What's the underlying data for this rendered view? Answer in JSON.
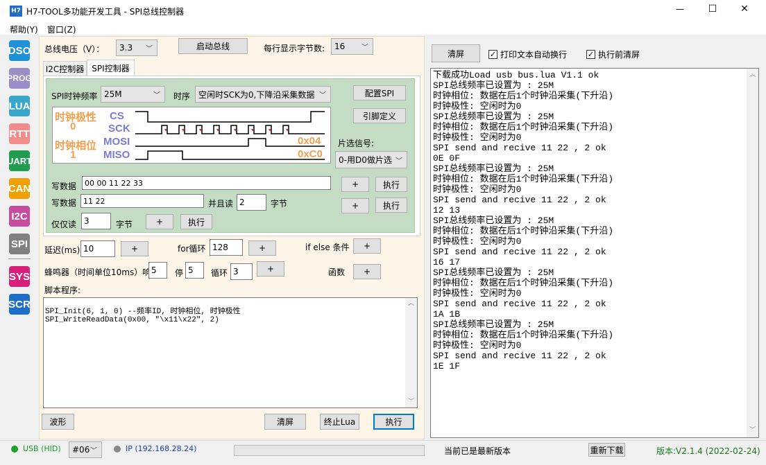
{
  "window": {
    "title": "H7-TOOL多功能开发工具 - SPI总线控制器",
    "app_icon": "H7",
    "min_glyph": "—",
    "max_glyph": "☐",
    "close_glyph": "✕"
  },
  "menu": [
    "帮助(Y)",
    "窗口(Z)"
  ],
  "sidebar": [
    {
      "label": "DSO",
      "color": "#1e90d8"
    },
    {
      "label": "PROG",
      "color": "#9b8dc8"
    },
    {
      "label": "LUA",
      "color": "#37a6c8"
    },
    {
      "label": "RTT",
      "color": "#f08c8c"
    },
    {
      "label": "UART",
      "color": "#1e9e4e"
    },
    {
      "label": "CAN",
      "color": "#f0a000"
    },
    {
      "label": "I2C",
      "color": "#c84c9e"
    },
    {
      "label": "SPI",
      "color": "#808080"
    },
    {
      "label": "SYS",
      "color": "#d8207a"
    },
    {
      "label": "SCR",
      "color": "#1e6ec8"
    }
  ],
  "top": {
    "voltage_label": "总线电压（V）：",
    "voltage_value": "3.3",
    "start_bus": "启动总线",
    "bytes_per_line_label": "每行显示字节数:",
    "bytes_per_line_value": "16"
  },
  "tabs": [
    "I2C控制器",
    "SPI控制器"
  ],
  "spi": {
    "clock_label": "SPI时钟频率",
    "clock_value": "25M",
    "timing_label": "时序",
    "timing_value": "空闲时SCK为0,下降沿采集数据",
    "config_btn": "配置SPI",
    "pin_btn": "引脚定义",
    "cs_select_label": "片选信号:",
    "cs_select_value": "0-用D0做片选",
    "wave": {
      "polarity_label": "时钟极性",
      "polarity_value": "0",
      "phase_label": "时钟相位",
      "phase_value": "1",
      "cs": "CS",
      "sck": "SCK",
      "mosi": "MOSI",
      "miso": "MISO",
      "mosi_hex": "0x04",
      "miso_hex": "0xC0"
    },
    "write1_label": "写数据",
    "write1_value": "00 00 11 22 33",
    "write2_label": "写数据",
    "write2_value": "11 22",
    "and_read_label": "并且读",
    "and_read_value": "2",
    "bytes_unit": "字节",
    "read_only_label": "仅仅读",
    "read_only_value": "3",
    "bytes_unit2": "字节",
    "plus": "+",
    "exec": "执行"
  },
  "script": {
    "delay_label": "延迟(ms)",
    "delay_value": "10",
    "for_label": "for循环",
    "for_value": "128",
    "ifelse_label": "if else 条件",
    "beep_label": "蜂鸣器（时间单位10ms）响",
    "beep_on": "5",
    "stop_label": "停",
    "beep_off": "5",
    "loop_label": "循环",
    "loop_value": "3",
    "func_label": "函数",
    "program_label": "脚本程序:",
    "lines": [
      "SPI_Init(6, 1, 0) --频率ID, 时钟相位, 时钟极性",
      "SPI_WriteReadData(0x00, \"\\x11\\x22\", 2)"
    ],
    "wave_btn": "波形",
    "clear_btn": "清屏",
    "stop_lua_btn": "终止Lua",
    "run_btn": "执行"
  },
  "right": {
    "clear_btn": "清屏",
    "auto_wrap": "打印文本自动换行",
    "clear_before": "执行前清屏",
    "log": [
      "下载成功Load usb bus.lua V1.1 ok",
      "SPI总线频率已设置为 : 25M",
      "时钟相位: 数据在后1个时钟沿采集(下升沿)",
      "时钟极性: 空闲时为0",
      "SPI总线频率已设置为 : 25M",
      "时钟相位: 数据在后1个时钟沿采集(下升沿)",
      "时钟极性: 空闲时为0",
      "SPI send and recive 11 22 , 2 ok",
      "0E 0F",
      "SPI总线频率已设置为 : 25M",
      "时钟相位: 数据在后1个时钟沿采集(下升沿)",
      "时钟极性: 空闲时为0",
      "SPI send and recive 11 22 , 2 ok",
      "12 13",
      "SPI总线频率已设置为 : 25M",
      "时钟相位: 数据在后1个时钟沿采集(下升沿)",
      "时钟极性: 空闲时为0",
      "SPI send and recive 11 22 , 2 ok",
      "16 17",
      "SPI总线频率已设置为 : 25M",
      "时钟相位: 数据在后1个时钟沿采集(下升沿)",
      "时钟极性: 空闲时为0",
      "SPI send and recive 11 22 , 2 ok",
      "1A 1B",
      "SPI总线频率已设置为 : 25M",
      "时钟相位: 数据在后1个时钟沿采集(下升沿)",
      "时钟极性: 空闲时为0",
      "SPI send and recive 11 22 , 2 ok",
      "1E 1F"
    ]
  },
  "status": {
    "usb": "USB (HID)",
    "device": "#06",
    "ip": "IP (192.168.28.24)",
    "latest": "当前已是最新版本",
    "redownload": "重新下载",
    "version": "版本:V2.1.4 (2022-02-24)",
    "usb_color": "#1a9e2e",
    "ip_color": "#1e3ea8",
    "version_color": "#1a7a1a"
  }
}
